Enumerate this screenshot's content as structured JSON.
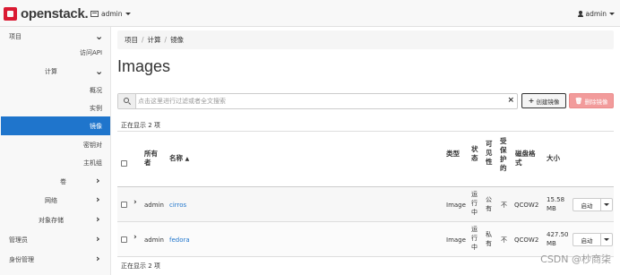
{
  "navbar": {
    "logo_text": "openstack.",
    "project_label": "admin",
    "user_label": "admin"
  },
  "sidebar": {
    "items": [
      {
        "label": "项目",
        "level": 0,
        "expanded": true
      },
      {
        "label": "访问API",
        "level": 2
      },
      {
        "label": "计算",
        "level": 1,
        "expanded": true
      },
      {
        "label": "概况",
        "level": 2
      },
      {
        "label": "实例",
        "level": 2
      },
      {
        "label": "镜像",
        "level": 2,
        "active": true
      },
      {
        "label": "密钥对",
        "level": 2
      },
      {
        "label": "主机组",
        "level": 2
      },
      {
        "label": "卷",
        "level": 1
      },
      {
        "label": "网络",
        "level": 1
      },
      {
        "label": "对象存储",
        "level": 1
      },
      {
        "label": "管理员",
        "level": 0
      },
      {
        "label": "身份管理",
        "level": 0
      }
    ]
  },
  "breadcrumb": [
    "项目",
    "计算",
    "镜像"
  ],
  "page_title": "Images",
  "search": {
    "placeholder": "点击这里进行过滤或者全文搜索"
  },
  "actions": {
    "create": "创建镜像",
    "delete": "删除镜像"
  },
  "count_text": "正在显示 2 项",
  "table": {
    "headers": {
      "owner": "所有者",
      "name": "名称",
      "type": "类型",
      "status": "状态",
      "visibility": "可见性",
      "protected": "受保护的",
      "disk_format": "磁盘格式",
      "size": "大小"
    },
    "rows": [
      {
        "owner": "admin",
        "name": "cirros",
        "type": "Image",
        "status": "运行中",
        "visibility": "公有",
        "protected": "不",
        "disk_format": "QCOW2",
        "size": "15.58 MB",
        "action": "启动"
      },
      {
        "owner": "admin",
        "name": "fedora",
        "type": "Image",
        "status": "运行中",
        "visibility": "私有",
        "protected": "不",
        "disk_format": "QCOW2",
        "size": "427.50 MB",
        "action": "启动"
      }
    ]
  },
  "watermark": "CSDN @杪商柒"
}
